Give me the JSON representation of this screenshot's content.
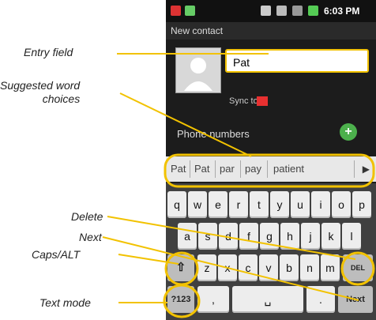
{
  "callouts": {
    "entry_field": "Entry field",
    "suggested_line1": "Suggested word",
    "suggested_line2": "choices",
    "delete": "Delete",
    "next": "Next",
    "caps_alt": "Caps/ALT",
    "text_mode": "Text mode"
  },
  "status_bar": {
    "time": "6:03 PM"
  },
  "screen": {
    "title": "New contact",
    "entry_value": "Pat",
    "sync_to": "Sync to",
    "phone_numbers": "Phone numbers"
  },
  "suggestions": [
    "Pat",
    "Pat",
    "par",
    "pay",
    "patient"
  ],
  "keyboard": {
    "row1": [
      "q",
      "w",
      "e",
      "r",
      "t",
      "y",
      "u",
      "i",
      "o",
      "p"
    ],
    "row2": [
      "a",
      "s",
      "d",
      "f",
      "g",
      "h",
      "j",
      "k",
      "l"
    ],
    "row3": [
      "z",
      "x",
      "c",
      "v",
      "b",
      "n",
      "m"
    ],
    "delete_label": "DEL",
    "mode_label": "?123",
    "next_label": "Next"
  },
  "colors": {
    "callout_line": "#f2c200",
    "accent": "#4cb04c"
  }
}
